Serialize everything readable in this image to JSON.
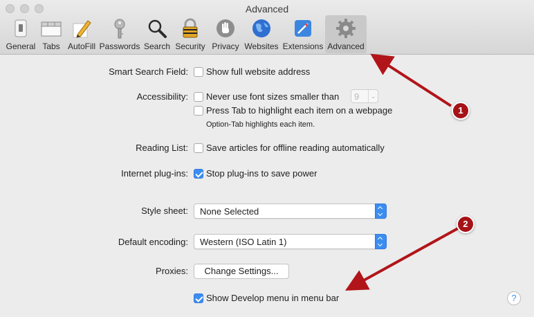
{
  "window": {
    "title": "Advanced"
  },
  "toolbar": [
    {
      "label": "General",
      "icon": "switch-icon"
    },
    {
      "label": "Tabs",
      "icon": "tabs-icon"
    },
    {
      "label": "AutoFill",
      "icon": "pencil-icon"
    },
    {
      "label": "Passwords",
      "icon": "key-icon"
    },
    {
      "label": "Search",
      "icon": "magnifier-icon"
    },
    {
      "label": "Security",
      "icon": "padlock-icon"
    },
    {
      "label": "Privacy",
      "icon": "hand-icon"
    },
    {
      "label": "Websites",
      "icon": "globe-icon"
    },
    {
      "label": "Extensions",
      "icon": "puzzle-icon"
    },
    {
      "label": "Advanced",
      "icon": "gear-icon",
      "active": true
    }
  ],
  "settings": {
    "smart_search_label": "Smart Search Field:",
    "smart_search_option": "Show full website address",
    "accessibility_label": "Accessibility:",
    "font_size_option": "Never use font sizes smaller than",
    "font_size_value": "9",
    "tab_highlight_option": "Press Tab to highlight each item on a webpage",
    "tab_highlight_note": "Option-Tab highlights each item.",
    "reading_list_label": "Reading List:",
    "reading_list_option": "Save articles for offline reading automatically",
    "plugins_label": "Internet plug-ins:",
    "plugins_option": "Stop plug-ins to save power",
    "stylesheet_label": "Style sheet:",
    "stylesheet_value": "None Selected",
    "encoding_label": "Default encoding:",
    "encoding_value": "Western (ISO Latin 1)",
    "proxies_label": "Proxies:",
    "proxies_button": "Change Settings...",
    "develop_menu_option": "Show Develop menu in menu bar",
    "help_button": "?"
  },
  "checkbox_states": {
    "smart_search": false,
    "font_size": false,
    "tab_highlight": false,
    "reading_list": false,
    "plugins": true,
    "develop_menu": true
  },
  "annotations": {
    "badge_1": "1",
    "badge_2": "2",
    "arrow_color": "#b1151a"
  },
  "colors": {
    "accent": "#3b8df1",
    "badge": "#a51217"
  }
}
